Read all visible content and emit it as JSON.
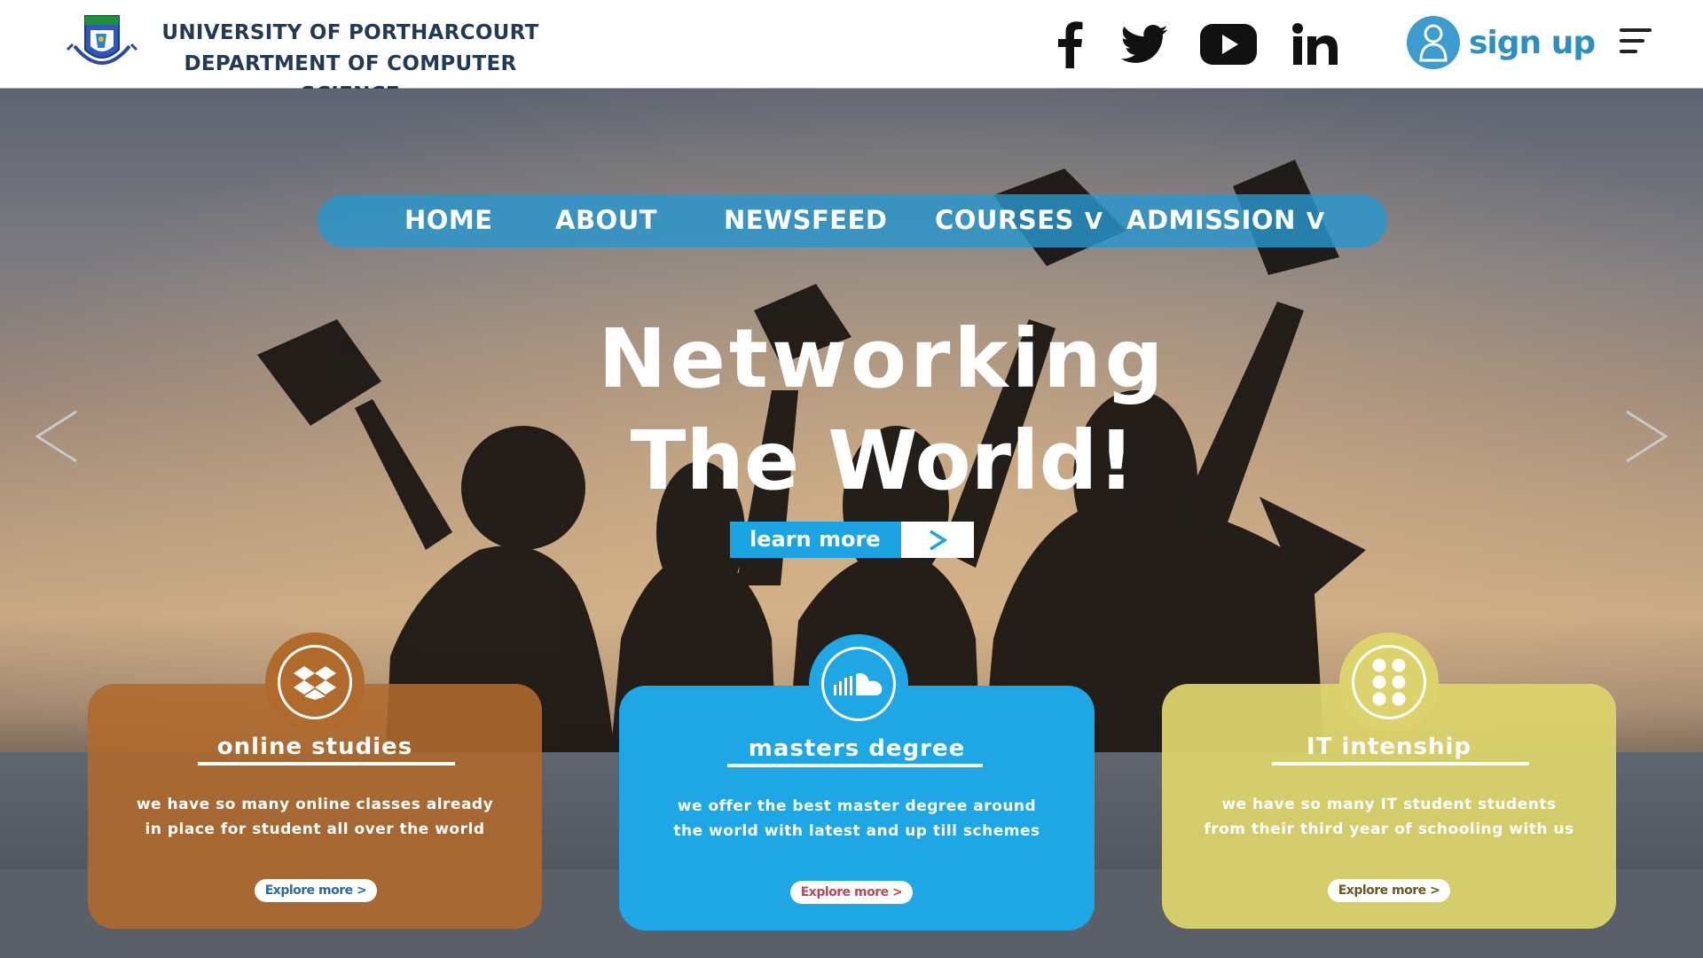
{
  "header": {
    "university_line1": "UNIVERSITY OF PORTHARCOURT",
    "university_line2": "DEPARTMENT OF COMPUTER SCIENCE",
    "signup_label": "sign up",
    "social_icons": [
      "facebook-icon",
      "twitter-icon",
      "youtube-icon",
      "linkedin-icon"
    ]
  },
  "nav": {
    "items": [
      {
        "label": "HOME"
      },
      {
        "label": "ABOUT"
      },
      {
        "label": "NEWSFEED"
      },
      {
        "label": "COURSES",
        "dropdown": true
      },
      {
        "label": "ADMISSION",
        "dropdown": true
      }
    ],
    "dropdown_glyph": "V"
  },
  "hero": {
    "headline_line1": "Networking",
    "headline_line2": "The World!",
    "cta_label": "learn more"
  },
  "cards": [
    {
      "title": "online studies",
      "desc_line1": "we have so many online classes already",
      "desc_line2": "in place for student all over the world",
      "button_label": "Explore more",
      "color": "#b06a2c",
      "icon": "dropbox-icon"
    },
    {
      "title": "masters degree",
      "desc_line1": "we offer the best master degree around",
      "desc_line2": "the world with latest and up till schemes",
      "button_label": "Explore more",
      "color": "#1ea6e5",
      "icon": "soundcloud-icon"
    },
    {
      "title": "IT intenship",
      "desc_line1": "we have so many IT student students",
      "desc_line2": "from their third year of schooling with us",
      "button_label": "Explore more",
      "color": "#dcd36c",
      "icon": "grid-dots-icon"
    }
  ],
  "colors": {
    "header_text": "#233a56",
    "accent": "#1ca3e2",
    "nav_bg": "#2896cd"
  }
}
